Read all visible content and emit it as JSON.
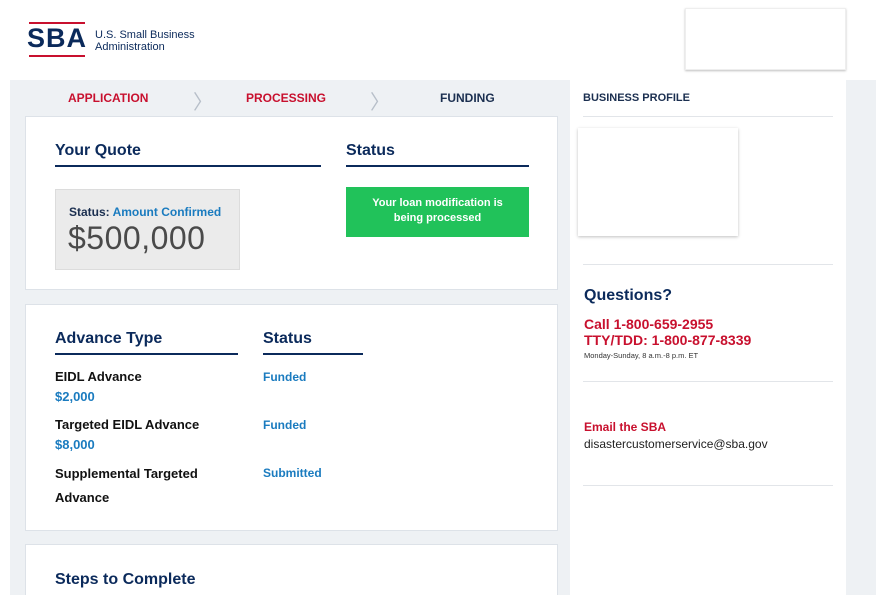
{
  "header": {
    "logo_mark": "SBA",
    "logo_line1": "U.S. Small Business",
    "logo_line2": "Administration"
  },
  "steps": [
    {
      "label": "APPLICATION",
      "state": "active"
    },
    {
      "label": "PROCESSING",
      "state": "active"
    },
    {
      "label": "FUNDING",
      "state": "pending"
    }
  ],
  "quote": {
    "title": "Your Quote",
    "status_label": "Status:",
    "status_value": "Amount Confirmed",
    "amount": "$500,000"
  },
  "status": {
    "title": "Status",
    "banner_line1": "Your loan modification is",
    "banner_line2": "being processed"
  },
  "advance": {
    "type_title": "Advance Type",
    "status_title": "Status",
    "items": [
      {
        "name": "EIDL Advance",
        "amount": "$2,000",
        "status": "Funded"
      },
      {
        "name": "Targeted EIDL Advance",
        "amount": "$8,000",
        "status": "Funded"
      },
      {
        "name_line1": "Supplemental Targeted",
        "name_line2": "Advance",
        "status": "Submitted"
      }
    ]
  },
  "steps_to_complete": {
    "title": "Steps to Complete"
  },
  "sidebar": {
    "profile_title": "BUSINESS PROFILE",
    "questions_title": "Questions?",
    "call": "Call 1-800-659-2955",
    "tty": "TTY/TDD: 1-800-877-8339",
    "hours": "Monday-Sunday, 8 a.m.-8 p.m. ET",
    "email_label": "Email the SBA",
    "email_address": "disastercustomerservice@sba.gov"
  },
  "colors": {
    "brand_navy": "#0b2a5b",
    "brand_red": "#c8102e",
    "link_blue": "#1a7bbf",
    "success_green": "#21c25a"
  }
}
